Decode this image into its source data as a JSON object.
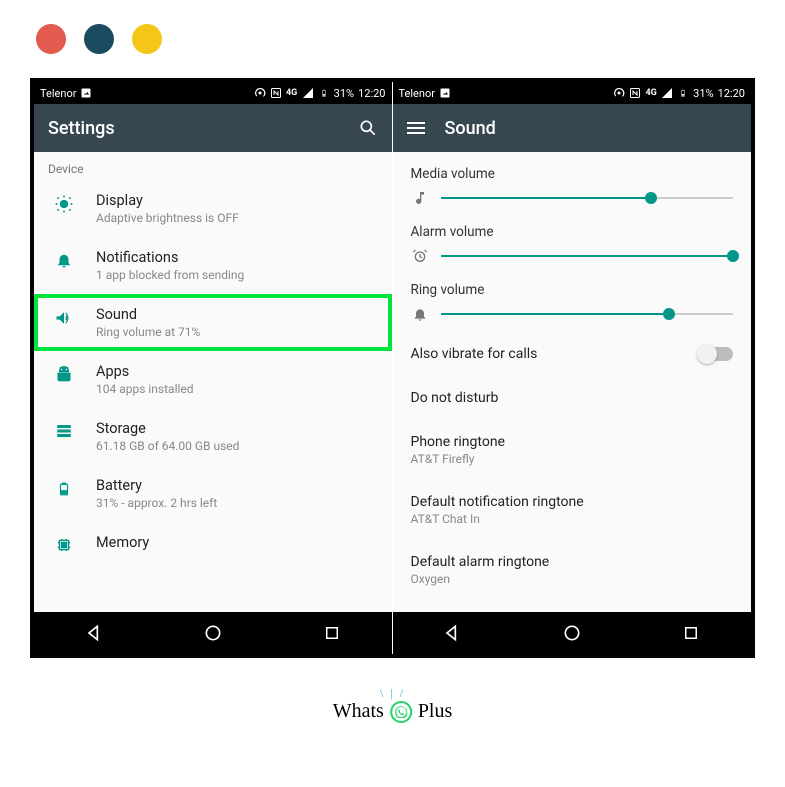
{
  "statusbar": {
    "carrier": "Telenor",
    "battery": "31%",
    "time": "12:20"
  },
  "left": {
    "appbar_title": "Settings",
    "section": "Device",
    "items": [
      {
        "title": "Display",
        "sub": "Adaptive brightness is OFF"
      },
      {
        "title": "Notifications",
        "sub": "1 app blocked from sending"
      },
      {
        "title": "Sound",
        "sub": "Ring volume at 71%"
      },
      {
        "title": "Apps",
        "sub": "104 apps installed"
      },
      {
        "title": "Storage",
        "sub": "61.18 GB of 64.00 GB used"
      },
      {
        "title": "Battery",
        "sub": "31% - approx. 2 hrs left"
      },
      {
        "title": "Memory",
        "sub": ""
      }
    ]
  },
  "right": {
    "appbar_title": "Sound",
    "sliders": [
      {
        "label": "Media volume",
        "value": 72
      },
      {
        "label": "Alarm volume",
        "value": 100
      },
      {
        "label": "Ring volume",
        "value": 78
      }
    ],
    "vibrate_label": "Also vibrate for calls",
    "items": [
      {
        "title": "Do not disturb",
        "sub": ""
      },
      {
        "title": "Phone ringtone",
        "sub": "AT&T Firefly"
      },
      {
        "title": "Default notification ringtone",
        "sub": "AT&T Chat In"
      },
      {
        "title": "Default alarm ringtone",
        "sub": "Oxygen"
      }
    ]
  },
  "brand": {
    "left": "Whats",
    "right": "Plus"
  }
}
